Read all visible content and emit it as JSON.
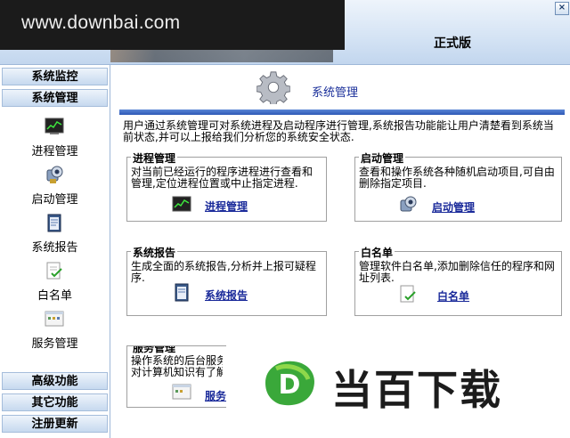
{
  "watermark": {
    "site": "www.downbai.com",
    "brand": "当百下载",
    "brand_logo_letter": "D"
  },
  "window": {
    "close_glyph": "×",
    "edition": "正式版"
  },
  "sidebar": {
    "top_headers": [
      "系统监控",
      "系统管理"
    ],
    "items": [
      {
        "label": "进程管理",
        "icon": "process-icon"
      },
      {
        "label": "启动管理",
        "icon": "startup-icon"
      },
      {
        "label": "系统报告",
        "icon": "report-icon"
      },
      {
        "label": "白名单",
        "icon": "whitelist-icon"
      },
      {
        "label": "服务管理",
        "icon": "service-icon"
      }
    ],
    "bottom_headers": [
      "高级功能",
      "其它功能",
      "注册更新"
    ]
  },
  "main": {
    "title": "系统管理",
    "intro": "用户通过系统管理可对系统进程及启动程序进行管理,系统报告功能能让用户清楚看到系统当前状态,并可以上报给我们分析您的系统安全状态.",
    "sections": [
      {
        "title": "进程管理",
        "desc": "对当前已经运行的程序进程进行查看和管理,定位进程位置或中止指定进程.",
        "link": "进程管理"
      },
      {
        "title": "启动管理",
        "desc": "查看和操作系统各种随机启动项目,可自由删除指定项目.",
        "link": "启动管理"
      },
      {
        "title": "系统报告",
        "desc": "生成全面的系统报告,分析并上报可疑程序.",
        "link": "系统报告"
      },
      {
        "title": "白名单",
        "desc": "管理软件白名单,添加删除信任的程序和网址列表.",
        "link": "白名单"
      },
      {
        "title": "服务管理",
        "desc": "操作系统的后台服务\n对计算机知识有了解",
        "link": "服务"
      }
    ]
  },
  "colors": {
    "accent_blue": "#2d58b6",
    "link": "#1a2a9a",
    "brand_green": "#3aa83a"
  }
}
